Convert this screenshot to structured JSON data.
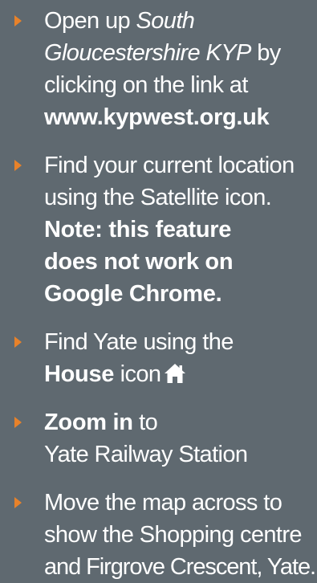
{
  "colors": {
    "background": "#5f6970",
    "text": "#ffffff",
    "bullet": "#e8822a"
  },
  "steps": [
    {
      "line1_plain": "Open up ",
      "line1_italic": "South",
      "line2_italic": "Gloucestershire KYP",
      "line2_plain": " by",
      "line3": "clicking on the link at",
      "line4_bold": "www.kypwest.org.uk"
    },
    {
      "line1": "Find your current location",
      "line2": "using the Satellite icon.",
      "line3_bold": "Note: this feature",
      "line4_bold": "does not work on",
      "line5_bold": "Google Chrome."
    },
    {
      "line1": "Find Yate using the",
      "line2_bold": "House",
      "line2_plain": " icon",
      "icon": "house-icon"
    },
    {
      "line1_bold": "Zoom in",
      "line1_plain": " to",
      "line2": "Yate Railway Station"
    },
    {
      "line1": "Move the map across to",
      "line2": "show the Shopping centre",
      "line3": "and Firgrove Crescent, Yate."
    }
  ]
}
